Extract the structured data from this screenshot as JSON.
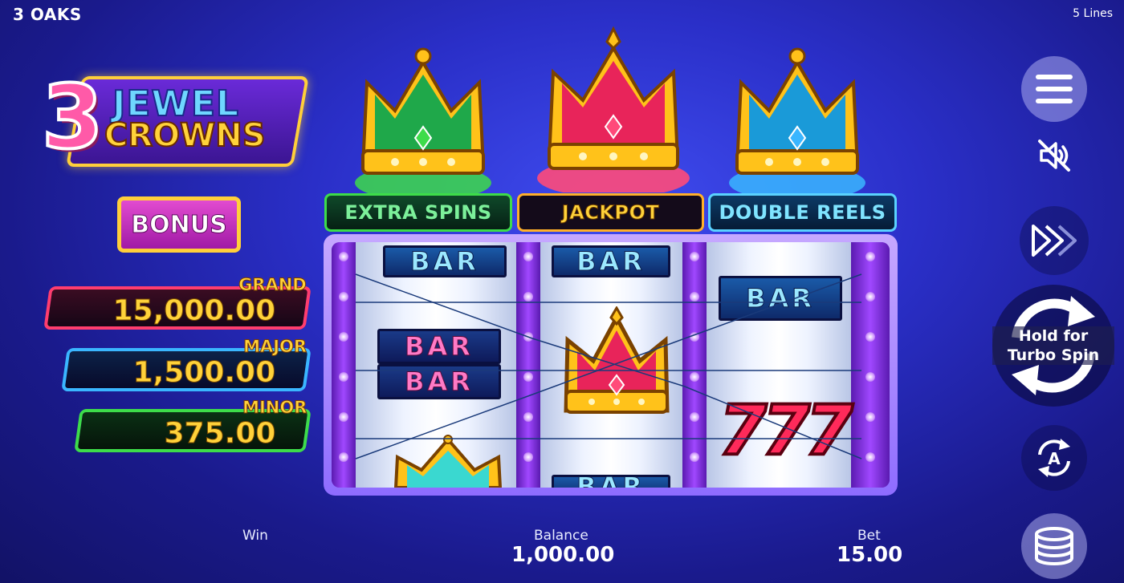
{
  "header": {
    "brand": "3 OAKS",
    "lines": "5 Lines"
  },
  "logo": {
    "number": "3",
    "line1": "JEWEL",
    "line2": "CROWNS"
  },
  "bonus_button": {
    "label": "BONUS"
  },
  "jackpots": [
    {
      "name": "GRAND",
      "value": "15,000.00",
      "color": "#ff3d6e"
    },
    {
      "name": "MAJOR",
      "value": "1,500.00",
      "color": "#3ab6ff"
    },
    {
      "name": "MINOR",
      "value": "375.00",
      "color": "#3ddc4a"
    }
  ],
  "features": [
    {
      "label": "EXTRA SPINS",
      "color": "#3ddc4a",
      "icon": "green-crown-icon"
    },
    {
      "label": "JACKPOT",
      "color": "#ffb02a",
      "icon": "pink-crown-icon"
    },
    {
      "label": "DOUBLE REELS",
      "color": "#5ad2ff",
      "icon": "blue-crown-icon"
    }
  ],
  "reels": {
    "reel1": [
      "BAR",
      "BAR",
      "BAR",
      "crown-icon"
    ],
    "reel2": [
      "BAR",
      "crown-icon",
      "BAR"
    ],
    "reel3": [
      "BAR",
      "777"
    ]
  },
  "footer": {
    "win_label": "Win",
    "balance_label": "Balance",
    "balance_value": "1,000.00",
    "bet_label": "Bet",
    "bet_value": "15.00"
  },
  "controls": {
    "spin_hint_line1": "Hold for",
    "spin_hint_line2": "Turbo Spin",
    "auto_letter": "A",
    "icons": [
      "menu-icon",
      "sound-off-icon",
      "turbo-icon",
      "spin-icon",
      "autoplay-icon",
      "coins-icon"
    ]
  }
}
